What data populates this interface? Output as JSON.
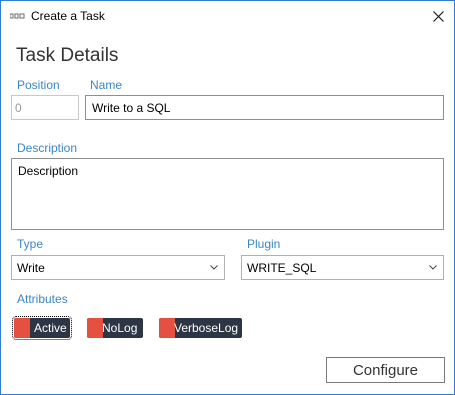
{
  "window": {
    "title": "Create a Task"
  },
  "header": {
    "title": "Task Details"
  },
  "fields": {
    "position": {
      "label": "Position",
      "value": "0"
    },
    "name": {
      "label": "Name",
      "value": "Write to a SQL"
    },
    "description": {
      "label": "Description",
      "value": "Description"
    },
    "type": {
      "label": "Type",
      "value": "Write"
    },
    "plugin": {
      "label": "Plugin",
      "value": "WRITE_SQL"
    }
  },
  "attributes": {
    "label": "Attributes",
    "items": [
      {
        "label": "Active",
        "focused": true
      },
      {
        "label": "NoLog",
        "focused": false
      },
      {
        "label": "VerboseLog",
        "focused": false
      }
    ]
  },
  "actions": {
    "configure": "Configure"
  },
  "colors": {
    "accent_label": "#3a86c8",
    "chip_bg": "#2d3644",
    "chip_swatch": "#e65041",
    "window_border": "#2f7bd6"
  },
  "icons": {
    "app": "app-logo-icon",
    "close": "close-icon",
    "dropdown": "chevron-down-icon"
  }
}
